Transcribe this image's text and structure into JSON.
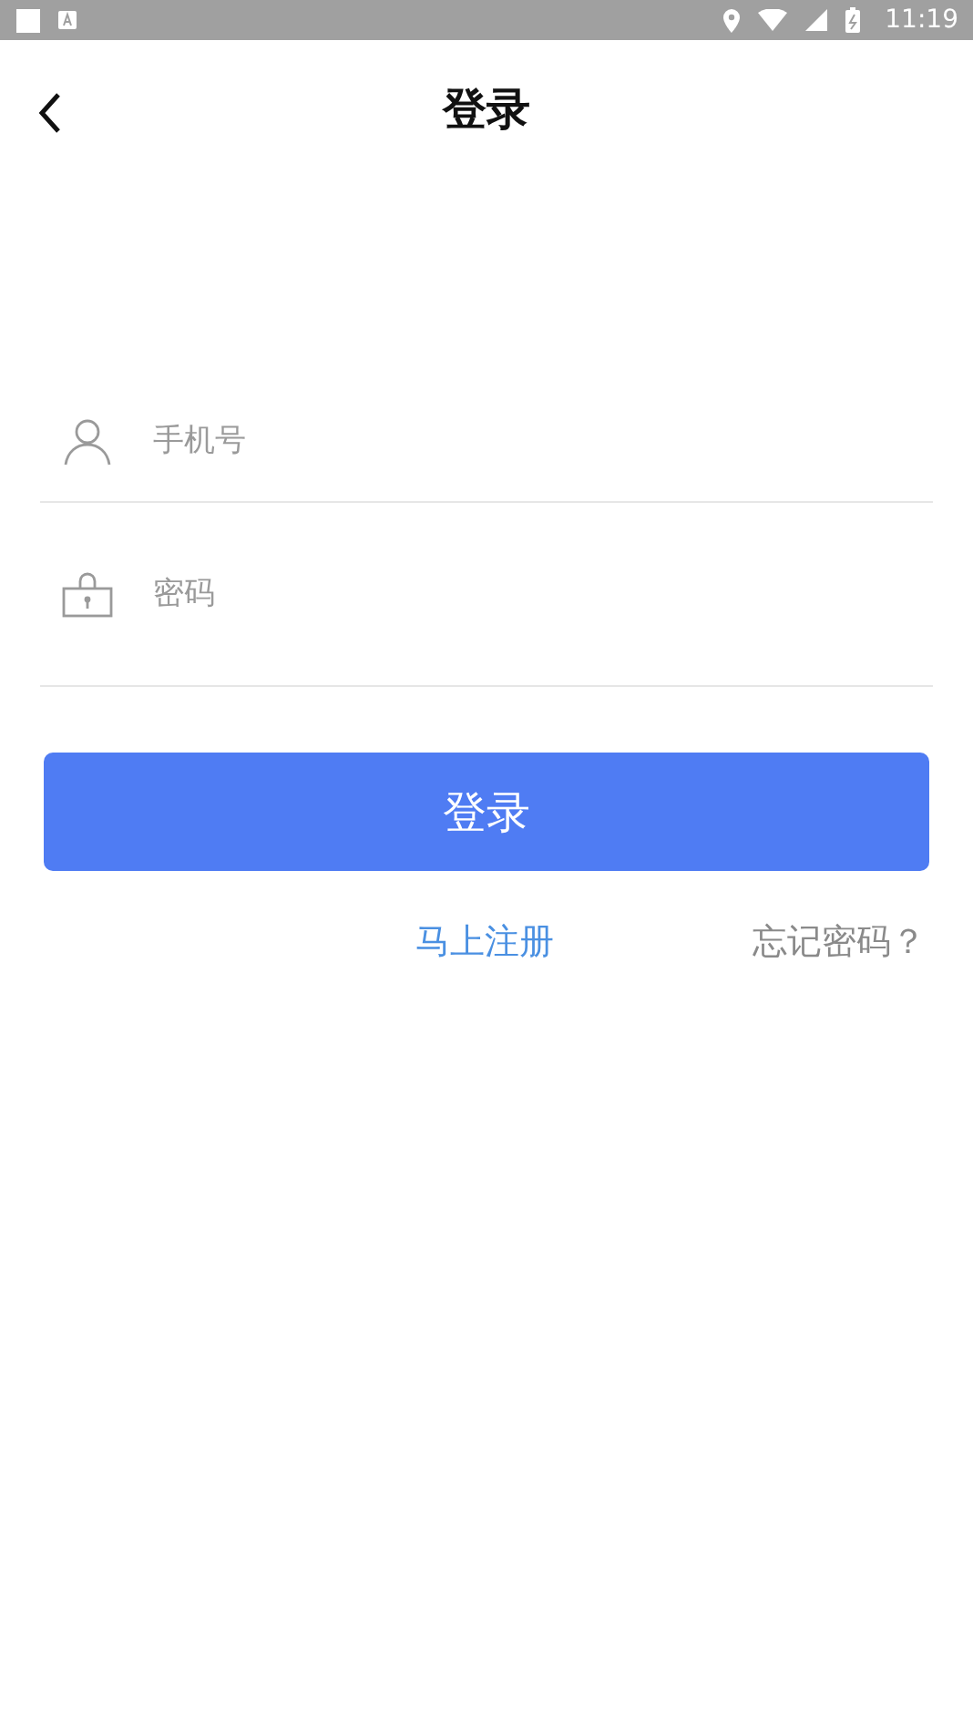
{
  "status_bar": {
    "time": "11:19"
  },
  "header": {
    "title": "登录"
  },
  "fields": [
    {
      "kind": "phone",
      "placeholder": "手机号"
    },
    {
      "kind": "password",
      "placeholder": "密码"
    }
  ],
  "login_button": "登录",
  "links": {
    "register": "马上注册",
    "forgot": "忘记密码？"
  }
}
